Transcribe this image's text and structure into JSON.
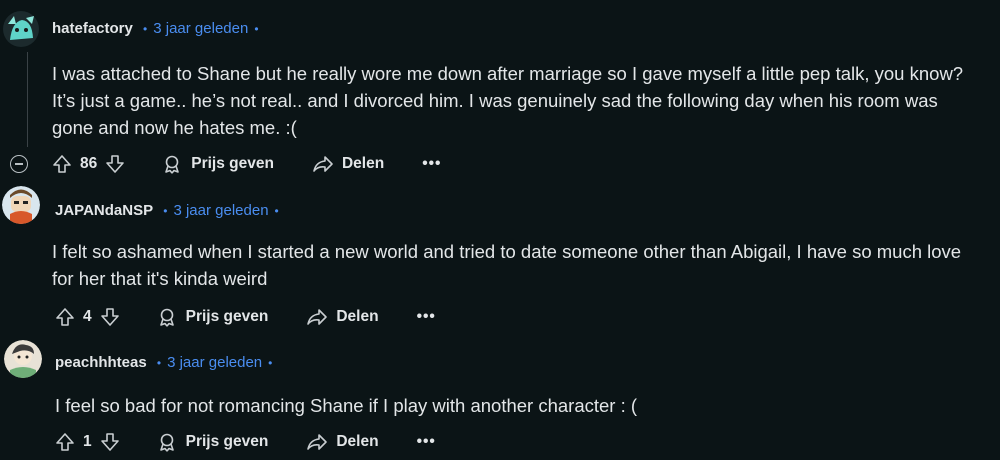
{
  "comments": [
    {
      "username": "hatefactory",
      "time": "3 jaar geleden",
      "text": "I was attached to Shane but he really wore me down after marriage so I gave myself a little pep talk, you know? It’s just a game.. he’s not real.. and I divorced him. I was genuinely sad the following day when his room was gone and now he hates me. :(",
      "votes": "86",
      "award_label": "Prijs geven",
      "share_label": "Delen",
      "more_label": "•••"
    },
    {
      "username": "JAPANdaNSP",
      "time": "3 jaar geleden",
      "text": "I felt so ashamed when I started a new world and tried to date someone other than Abigail, I have so much love for her that it's kinda weird",
      "votes": "4",
      "award_label": "Prijs geven",
      "share_label": "Delen",
      "more_label": "•••"
    },
    {
      "username": "peachhhteas",
      "time": "3 jaar geleden",
      "text": "I feel so bad for not romancing Shane if I play with another character : (",
      "votes": "1",
      "award_label": "Prijs geven",
      "share_label": "Delen",
      "more_label": "•••"
    }
  ],
  "separator": "•",
  "icons": [
    "upvote-icon",
    "downvote-icon",
    "award-icon",
    "share-icon",
    "collapse-icon",
    "more-icon"
  ],
  "colors": {
    "background": "#0b1416",
    "link": "#4a8df0",
    "text": "#e3e6e8"
  }
}
